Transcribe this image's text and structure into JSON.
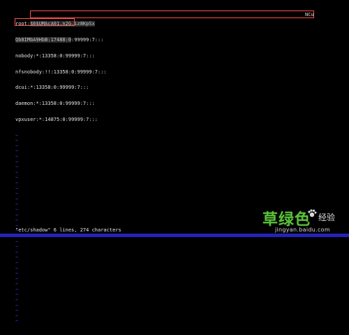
{
  "editor": {
    "lines": [
      {
        "prefix": "root:",
        "blurred": "$6$UMAcA01.n2G.iz8KpSx",
        "suffix": ""
      },
      {
        "prefix": "",
        "blurred": "Qb8IMbA9HbB:17488:0",
        "suffix": ":99999:7:::"
      },
      {
        "prefix": "nobody:*:13358:0:99999:7:::",
        "blurred": "",
        "suffix": ""
      },
      {
        "prefix": "nfsnobody:!!:13358:0:99999:7:::",
        "blurred": "",
        "suffix": ""
      },
      {
        "prefix": "dcui:*:13358:0:99999:7:::",
        "blurred": "",
        "suffix": ""
      },
      {
        "prefix": "daemon:*:13358:0:99999:7:::",
        "blurred": "",
        "suffix": ""
      },
      {
        "prefix": "vpxuser:*:14875:0:99999:7:::",
        "blurred": "",
        "suffix": ""
      }
    ],
    "row1_end": "NCu",
    "tilde": "~",
    "tilde_count": 36
  },
  "status": {
    "message": "\"etc/shadow\" 6 lines, 274 characters"
  },
  "watermark": {
    "brand": "草绿色",
    "suffix": "经验",
    "url": "jingyan.baidu.com"
  },
  "colors": {
    "background": "#000000",
    "text": "#e6e6e6",
    "tilde": "#3a3aff",
    "highlight": "#ff4d4d",
    "statusbar": "#2323b8",
    "watermark_green": "#5bbf3a"
  }
}
